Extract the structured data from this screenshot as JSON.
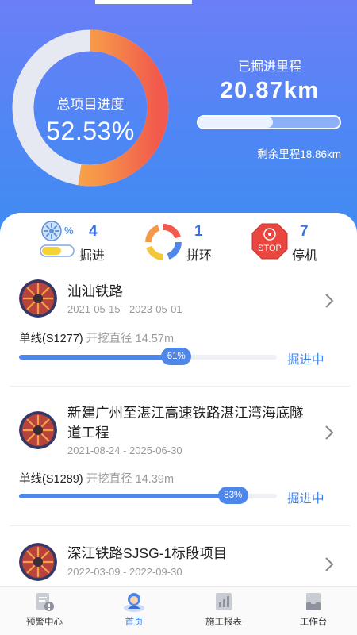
{
  "header": {
    "progress_label": "总项目进度",
    "progress_value": "52.53%",
    "progress_fraction": 0.5253,
    "dug_label": "已掘进里程",
    "dug_value": "20.87km",
    "dug_fraction": 0.53,
    "remaining": "剩余里程18.86km"
  },
  "stats": [
    {
      "icon": "tunneling-machine-icon",
      "count": "4",
      "label": "掘进"
    },
    {
      "icon": "ring-assembly-icon",
      "count": "1",
      "label": "拼环"
    },
    {
      "icon": "stop-sign-icon",
      "icon_text": "STOP",
      "count": "7",
      "label": "停机"
    }
  ],
  "projects": [
    {
      "name": "汕汕铁路",
      "dates": "2021-05-15 - 2023-05-01",
      "line": "单线(S1277)",
      "diameter": "开挖直径 14.57m",
      "percent_label": "61%",
      "percent": 61,
      "state": "掘进中"
    },
    {
      "name": "新建广州至湛江高速铁路湛江湾海底隧道工程",
      "dates": "2021-08-24 - 2025-06-30",
      "line": "单线(S1289)",
      "diameter": "开挖直径 14.39m",
      "percent_label": "83%",
      "percent": 83,
      "state": "掘进中"
    },
    {
      "name": "深江铁路SJSG-1标段项目",
      "dates": "2022-03-09 - 2022-09-30"
    }
  ],
  "tabs": [
    {
      "label": "预警中心",
      "icon": "warning-doc-icon"
    },
    {
      "label": "首页",
      "icon": "home-avatar-icon",
      "active": true
    },
    {
      "label": "施工报表",
      "icon": "report-chart-icon"
    },
    {
      "label": "工作台",
      "icon": "workbench-icon"
    }
  ],
  "colors": {
    "accent": "#4f86ea",
    "header_top": "#6b7ff7",
    "header_bottom": "#3f8cf2",
    "donut_track": "#e6e9f2",
    "donut_start": "#f7c244",
    "donut_end": "#f25c4c"
  }
}
